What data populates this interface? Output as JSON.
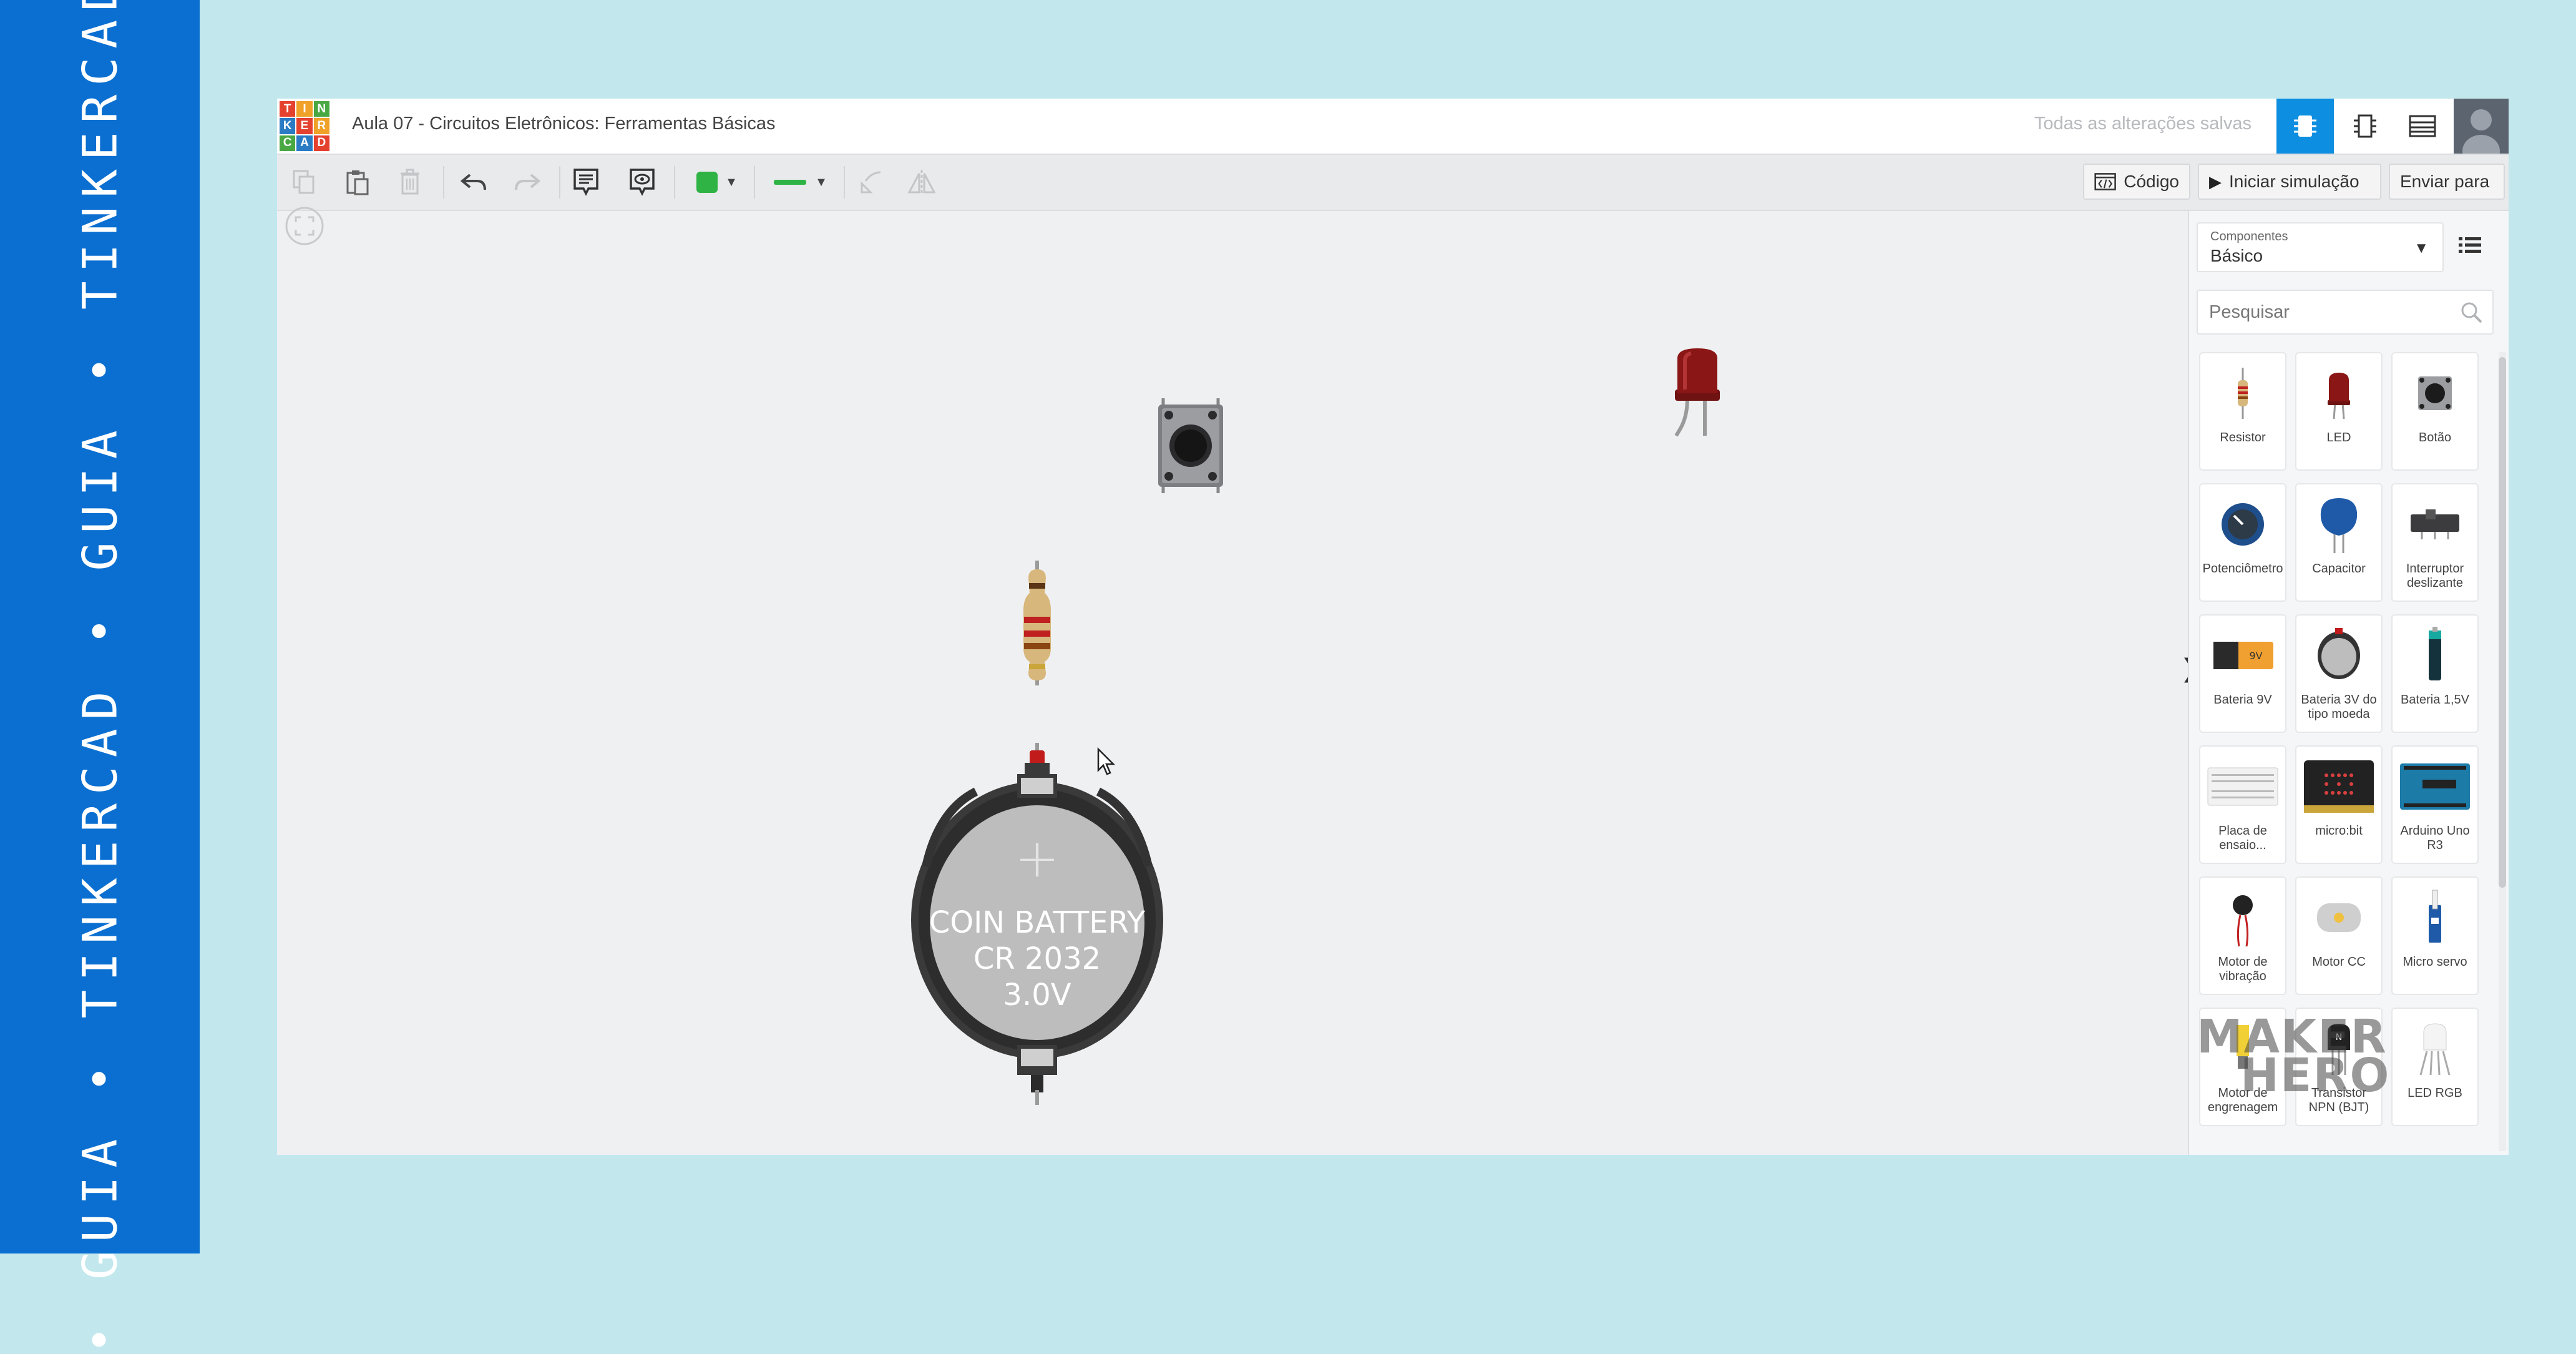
{
  "banner": {
    "text": "• GUIA • TINKERCAD • GUIA • TINKERCAD •"
  },
  "app": {
    "logo_letters": [
      "T",
      "I",
      "N",
      "K",
      "E",
      "R",
      "C",
      "A",
      "D"
    ],
    "logo_colors": [
      "#e5412f",
      "#f0a128",
      "#4aa843",
      "#2b7bc4",
      "#e5412f",
      "#f0a128",
      "#4aa843",
      "#2b7bc4",
      "#e5412f"
    ],
    "document_title": "Aula 07 - Circuitos Eletrônicos: Ferramentas Básicas",
    "save_status": "Todas as alterações salvas",
    "view_buttons": [
      "circuit-view-icon",
      "schematic-view-icon",
      "component-list-icon"
    ],
    "active_view_color": "#0d8ee0"
  },
  "toolbar": {
    "color_swatch": "#2fb344",
    "wire_color": "#2fb344",
    "code_label": "Código",
    "simulate_label": "Iniciar simulação",
    "send_label": "Enviar para"
  },
  "canvas": {
    "battery_text": [
      "COIN BATTERY",
      "CR 2032",
      "3.0V"
    ],
    "battery_plus": "+"
  },
  "panel": {
    "select_label": "Componentes",
    "select_value": "Básico",
    "search_placeholder": "Pesquisar",
    "components": [
      {
        "name": "Resistor",
        "icon": "resistor-icon"
      },
      {
        "name": "LED",
        "icon": "led-icon"
      },
      {
        "name": "Botão",
        "icon": "pushbutton-icon"
      },
      {
        "name": "Potenciômetro",
        "icon": "potentiometer-icon"
      },
      {
        "name": "Capacitor",
        "icon": "capacitor-icon"
      },
      {
        "name": "Interruptor deslizante",
        "icon": "slide-switch-icon"
      },
      {
        "name": "Bateria 9V",
        "icon": "battery-9v-icon"
      },
      {
        "name": "Bateria 3V do tipo moeda",
        "icon": "coin-battery-icon"
      },
      {
        "name": "Bateria 1,5V",
        "icon": "battery-aa-icon"
      },
      {
        "name": "Placa de ensaio...",
        "icon": "breadboard-icon"
      },
      {
        "name": "micro:bit",
        "icon": "microbit-icon"
      },
      {
        "name": "Arduino Uno R3",
        "icon": "arduino-icon"
      },
      {
        "name": "Motor de vibração",
        "icon": "vibration-motor-icon"
      },
      {
        "name": "Motor CC",
        "icon": "dc-motor-icon"
      },
      {
        "name": "Micro servo",
        "icon": "micro-servo-icon"
      },
      {
        "name": "Motor de engrenagem",
        "icon": "gear-motor-icon"
      },
      {
        "name": "Transistor NPN (BJT)",
        "icon": "npn-transistor-icon"
      },
      {
        "name": "LED RGB",
        "icon": "rgb-led-icon"
      }
    ]
  },
  "watermark": {
    "line1": "MAKER",
    "line2": "HERO"
  }
}
